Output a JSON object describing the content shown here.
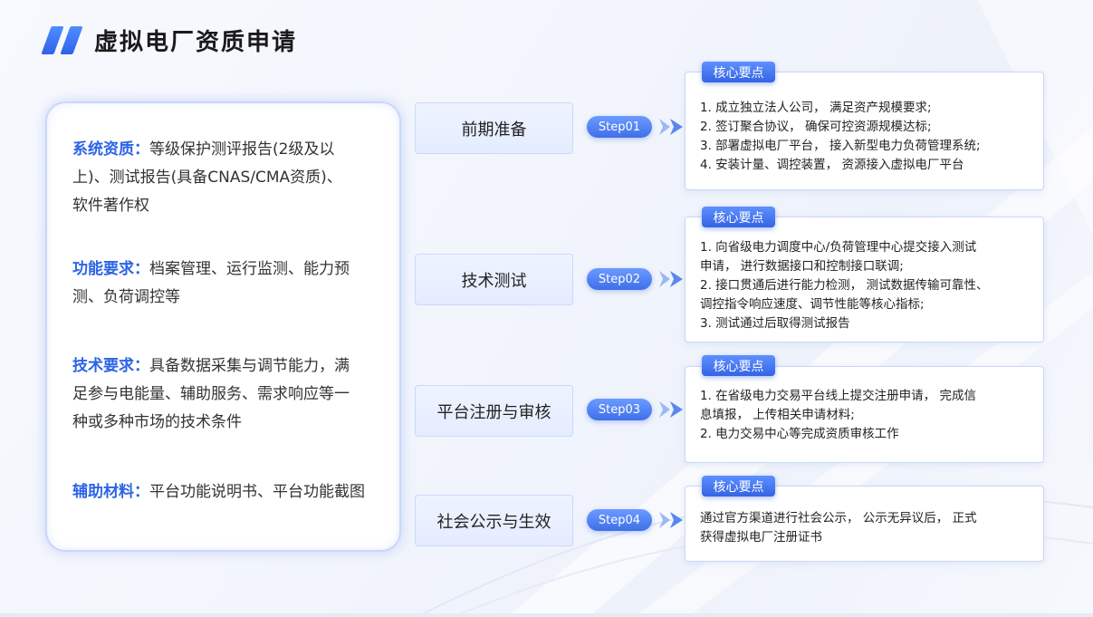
{
  "title": "虚拟电厂资质申请",
  "requirements": [
    {
      "label": "系统资质：",
      "lines": [
        "等级保护测评报告(2级及以",
        "上)、测试报告(具备CNAS/CMA资质)、",
        "软件著作权"
      ]
    },
    {
      "label": "功能要求：",
      "lines": [
        "档案管理、运行监测、能力预",
        "测、负荷调控等"
      ]
    },
    {
      "label": "技术要求：",
      "lines": [
        "具备数据采集与调节能力，满",
        "足参与电能量、辅助服务、需求响应等一",
        "种或多种市场的技术条件"
      ]
    },
    {
      "label": "辅助材料：",
      "lines": [
        "平台功能说明书、平台功能截图"
      ]
    }
  ],
  "steps": [
    {
      "name": "前期准备",
      "step": "Step01",
      "tag": "核心要点",
      "lines": [
        "1. 成立独立法人公司， 满足资产规模要求;",
        "2. 签订聚合协议， 确保可控资源规模达标;",
        "  3. 部署虚拟电厂平台， 接入新型电力负荷管理系统;",
        "4. 安装计量、调控装置， 资源接入虚拟电厂平台"
      ]
    },
    {
      "name": "技术测试",
      "step": "Step02",
      "tag": "核心要点",
      "lines": [
        "1. 向省级电力调度中心/负荷管理中心提交接入测试",
        "申请， 进行数据接口和控制接口联调;",
        "2. 接口贯通后进行能力检测， 测试数据传输可靠性、",
        "调控指令响应速度、调节性能等核心指标;",
        "3. 测试通过后取得测试报告"
      ]
    },
    {
      "name": "平台注册与审核",
      "step": "Step03",
      "tag": "核心要点",
      "lines": [
        "1. 在省级电力交易平台线上提交注册申请， 完成信",
        "息填报， 上传相关申请材料;",
        "2. 电力交易中心等完成资质审核工作"
      ]
    },
    {
      "name": "社会公示与生效",
      "step": "Step04",
      "tag": "核心要点",
      "lines": [
        "通过官方渠道进行社会公示， 公示无异议后， 正式",
        "获得虚拟电厂注册证书"
      ]
    }
  ],
  "colors": {
    "accent": "#2b64e6",
    "pill": "#4f7ff0"
  }
}
